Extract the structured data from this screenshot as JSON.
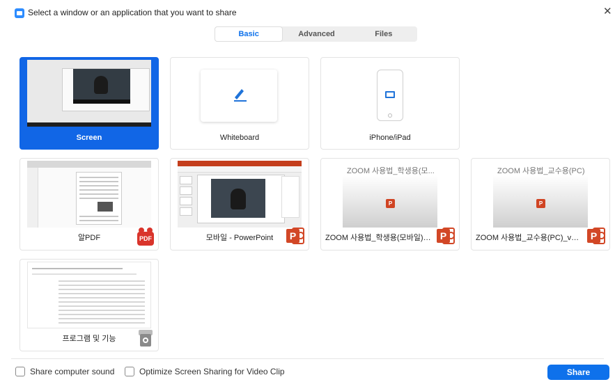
{
  "window": {
    "title": "Select a window or an application that you want to share",
    "close_glyph": "✕"
  },
  "tabs": [
    {
      "label": "Basic",
      "active": true
    },
    {
      "label": "Advanced",
      "active": false
    },
    {
      "label": "Files",
      "active": false
    }
  ],
  "tiles": {
    "screen": {
      "label": "Screen",
      "selected": true
    },
    "whiteboard": {
      "label": "Whiteboard"
    },
    "iphone": {
      "label": "iPhone/iPad"
    },
    "pdf_app": {
      "label": "알PDF",
      "icon_text": "PDF"
    },
    "ppt_mobile": {
      "label": "모바일 - PowerPoint",
      "icon_text": "P"
    },
    "zoom_student": {
      "label": "ZOOM 사용법_학생용(모바일)_v...",
      "thumb_title": "ZOOM 사용법_학생용(모...",
      "icon_text": "P"
    },
    "zoom_professor": {
      "label": "ZOOM 사용법_교수용(PC)_v2.0.p...",
      "thumb_title": "ZOOM 사용법_교수용(PC)...",
      "icon_text": "P"
    },
    "programs": {
      "label": "프로그램 및 기능"
    }
  },
  "footer": {
    "share_sound": {
      "label": "Share computer sound",
      "checked": false
    },
    "optimize_video": {
      "label": "Optimize Screen Sharing for Video Clip",
      "checked": false
    },
    "share_button": "Share"
  },
  "colors": {
    "accent": "#0e71eb",
    "selected_tile": "#1166e6",
    "ppt_red": "#d24726"
  }
}
